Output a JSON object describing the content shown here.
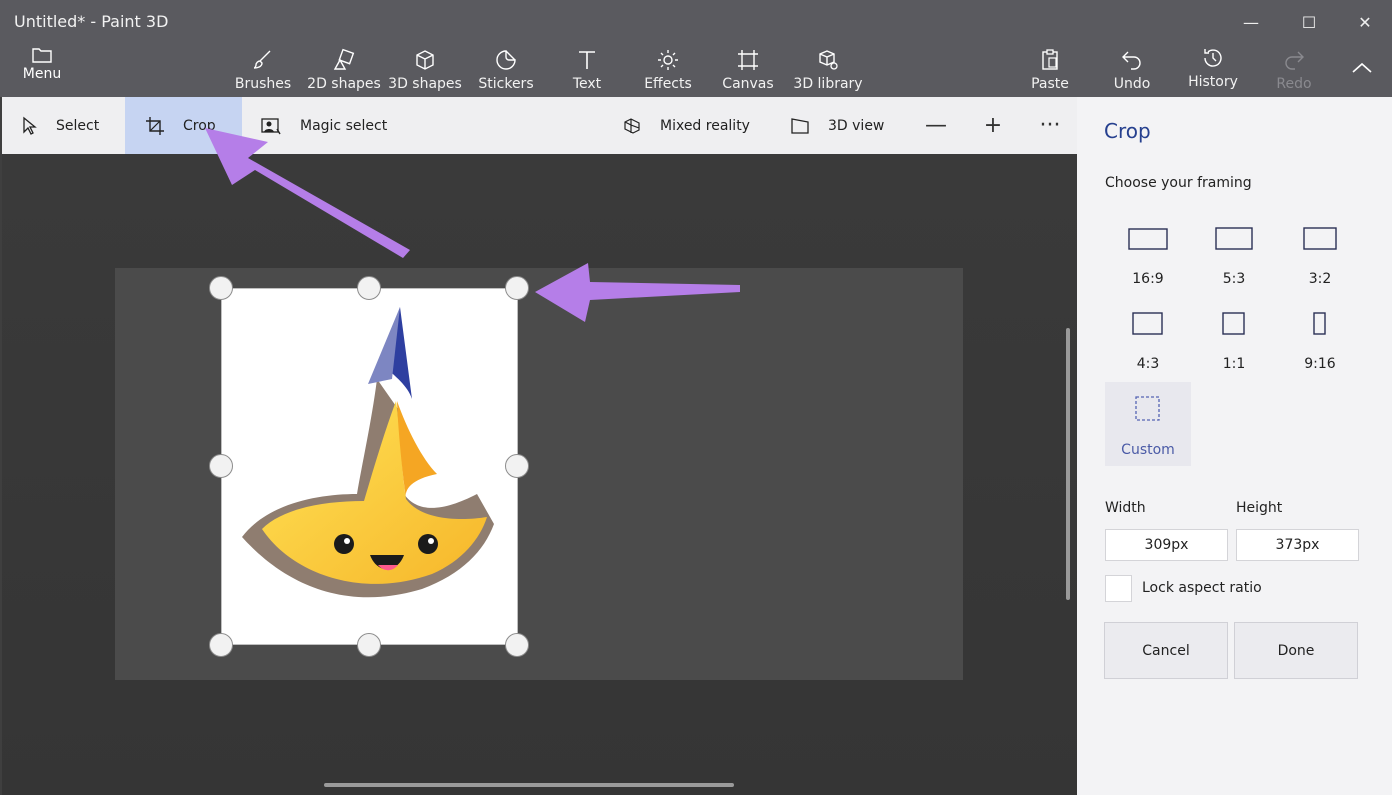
{
  "window": {
    "title": "Untitled* - Paint 3D",
    "minimize_glyph": "—",
    "maximize_glyph": "☐",
    "close_glyph": "✕"
  },
  "toolbar": {
    "menu_label": "Menu",
    "tools": [
      {
        "label": "Brushes",
        "icon": "brush-icon"
      },
      {
        "label": "2D shapes",
        "icon": "2d-shapes-icon"
      },
      {
        "label": "3D shapes",
        "icon": "3d-shapes-icon"
      },
      {
        "label": "Stickers",
        "icon": "stickers-icon"
      },
      {
        "label": "Text",
        "icon": "text-icon"
      },
      {
        "label": "Effects",
        "icon": "effects-icon"
      },
      {
        "label": "Canvas",
        "icon": "canvas-icon"
      },
      {
        "label": "3D library",
        "icon": "3d-library-icon"
      }
    ],
    "right_tools": [
      {
        "label": "Paste",
        "icon": "paste-icon"
      },
      {
        "label": "Undo",
        "icon": "undo-icon"
      },
      {
        "label": "History",
        "icon": "history-icon"
      },
      {
        "label": "Redo",
        "icon": "redo-icon",
        "disabled": true
      }
    ]
  },
  "subtoolbar": {
    "select_label": "Select",
    "crop_label": "Crop",
    "magic_select_label": "Magic select",
    "mixed_reality_label": "Mixed reality",
    "view_3d_label": "3D view",
    "zoom_out_glyph": "—",
    "zoom_in_glyph": "+",
    "more_glyph": "···"
  },
  "panel": {
    "title": "Crop",
    "subtitle": "Choose your framing",
    "framings": [
      {
        "label": "16:9",
        "icon": "ratio-16-9-icon"
      },
      {
        "label": "5:3",
        "icon": "ratio-5-3-icon"
      },
      {
        "label": "3:2",
        "icon": "ratio-3-2-icon"
      },
      {
        "label": "4:3",
        "icon": "ratio-4-3-icon"
      },
      {
        "label": "1:1",
        "icon": "ratio-1-1-icon"
      },
      {
        "label": "9:16",
        "icon": "ratio-9-16-icon"
      },
      {
        "label": "Custom",
        "icon": "custom-ratio-icon",
        "selected": true
      }
    ],
    "width_label": "Width",
    "height_label": "Height",
    "width_value": "309px",
    "height_value": "373px",
    "lock_aspect_label": "Lock aspect ratio",
    "lock_aspect_checked": false,
    "cancel_label": "Cancel",
    "done_label": "Done"
  },
  "colors": {
    "titlebar": "#5a5a5f",
    "accent": "#26408f",
    "annotation_arrow": "#b57ee8",
    "active_tool": "#c6d4f2"
  }
}
